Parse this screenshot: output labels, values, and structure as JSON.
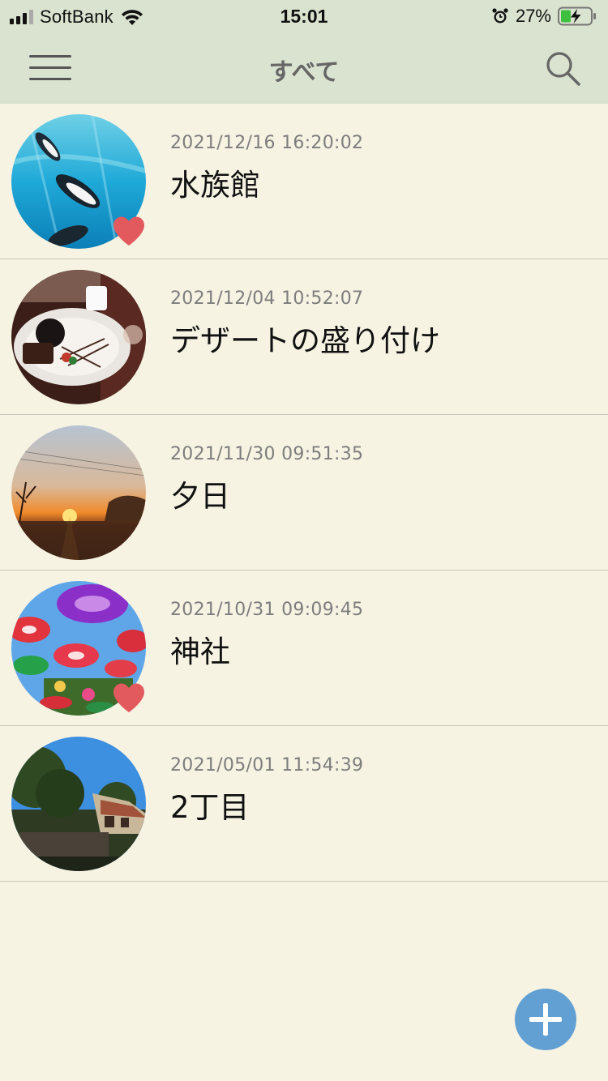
{
  "status_bar": {
    "carrier": "SoftBank",
    "time": "15:01",
    "battery_percent": "27%",
    "icons": [
      "signal-icon",
      "wifi-icon",
      "alarm-icon",
      "battery-charging-icon"
    ]
  },
  "nav": {
    "title": "すべて",
    "menu_icon": "hamburger-menu-icon",
    "search_icon": "search-icon"
  },
  "colors": {
    "header_bg": "#d9e3cf",
    "page_bg": "#f6f3e3",
    "favorite": "#e2595e",
    "fab": "#62a0d3"
  },
  "items": [
    {
      "date": "2021/12/16 16:20:02",
      "title": "水族館",
      "favorite": true,
      "photo": "penguins-aquarium"
    },
    {
      "date": "2021/12/04 10:52:07",
      "title": "デザートの盛り付け",
      "favorite": false,
      "photo": "dessert-plate"
    },
    {
      "date": "2021/11/30 09:51:35",
      "title": "夕日",
      "favorite": false,
      "photo": "sunset"
    },
    {
      "date": "2021/10/31 09:09:45",
      "title": "神社",
      "favorite": true,
      "photo": "umbrellas"
    },
    {
      "date": "2021/05/01 11:54:39",
      "title": "2丁目",
      "favorite": false,
      "photo": "house-trees"
    }
  ],
  "fab": {
    "icon": "plus-icon"
  }
}
